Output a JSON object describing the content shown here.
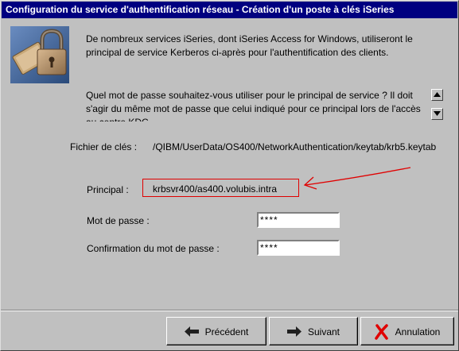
{
  "window": {
    "title": "Configuration du service d'authentification réseau - Création d'un poste à clés iSeries"
  },
  "intro": {
    "text": "De nombreux services iSeries, dont iSeries Access for Windows, utiliseront le principal de service Kerberos ci-après pour l'authentification des clients."
  },
  "question": {
    "text": "Quel mot de passe souhaitez-vous utiliser pour le principal de service ? Il doit s'agir du même mot de passe que celui indiqué pour ce principal lors de l'accès au centre KDC."
  },
  "keytab": {
    "label": "Fichier de clés :",
    "value": "/QIBM/UserData/OS400/NetworkAuthentication/keytab/krb5.keytab"
  },
  "principal": {
    "label": "Principal :",
    "value": "krbsvr400/as400.volubis.intra"
  },
  "password": {
    "label": "Mot de passe :",
    "value": "****"
  },
  "confirm": {
    "label": "Confirmation du mot de passe :",
    "value": "****"
  },
  "buttons": {
    "previous": "Précédent",
    "next": "Suivant",
    "cancel": "Annulation"
  },
  "colors": {
    "titlebar": "#000080",
    "annotation": "#e00000",
    "face": "#c0c0c0"
  },
  "icons": {
    "graphic": "padlock-icon",
    "previous": "arrow-left-icon",
    "next": "arrow-right-icon",
    "cancel": "red-x-icon",
    "scroll_up": "triangle-up-icon",
    "scroll_down": "triangle-down-icon"
  }
}
